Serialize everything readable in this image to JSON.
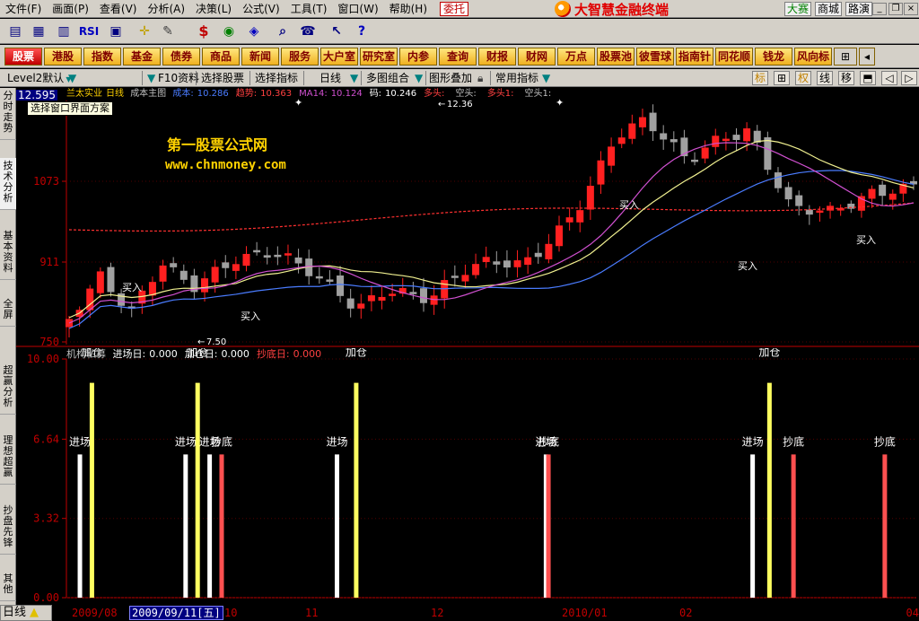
{
  "menu": {
    "items": [
      "文件(F)",
      "画面(P)",
      "查看(V)",
      "分析(A)",
      "决策(L)",
      "公式(V)",
      "工具(T)",
      "窗口(W)",
      "帮助(H)"
    ],
    "trade_button": "委托",
    "brand": "大智慧金融终端",
    "right_buttons": [
      "大赛",
      "商城",
      "路演"
    ]
  },
  "categories": [
    "股票",
    "港股",
    "指数",
    "基金",
    "债券",
    "商品",
    "新闻",
    "服务",
    "大户室",
    "研究室",
    "内参",
    "查询",
    "财报",
    "财网",
    "万点",
    "股票池",
    "彼雪球",
    "指南针",
    "同花顺",
    "钱龙",
    "风向标"
  ],
  "chart_toolbar": {
    "level2": "Level2默认",
    "f10": "F10资料",
    "select_stock": "选择股票",
    "select_indicator": "选择指标",
    "period": "日线",
    "multi_chart": "多图组合",
    "overlay": "图形叠加",
    "common_indicator": "常用指标",
    "right_buttons": [
      "标",
      "⊞",
      "权",
      "线",
      "移"
    ]
  },
  "left_tabs": [
    "分时走势",
    "技术分析",
    "基本资料",
    "全屏",
    "超赢分析",
    "理想超赢",
    "抄盘先锋",
    "其他"
  ],
  "price_chart": {
    "last_price": "12.595",
    "stock_name": "兰太实业",
    "period": "日线",
    "panel_name": "成本主图",
    "tooltip": "选择窗口界面方案",
    "indicators": [
      {
        "label": "成本:",
        "value": "10.286",
        "color": "#4a7cff"
      },
      {
        "label": "趋势:",
        "value": "10.363",
        "color": "#ff4040"
      },
      {
        "label": "MA14:",
        "value": "10.124",
        "color": "#d050d0"
      },
      {
        "label": "码:",
        "value": "10.246",
        "color": "#ffffff"
      },
      {
        "label": "多头:",
        "value": "",
        "color": "#ff4040"
      },
      {
        "label": "空头:",
        "value": "",
        "color": "#c0c0c0"
      },
      {
        "label": "多头1:",
        "value": "",
        "color": "#ff4040"
      },
      {
        "label": "空头1:",
        "value": "",
        "color": "#c0c0c0"
      }
    ],
    "y_ticks": [
      "1073",
      "911",
      "750"
    ],
    "high_label": "12.36",
    "low_label": "7.50",
    "buy_label": "买入",
    "watermark_title": "第一股票公式网",
    "watermark_url": "www.chnmoney.com",
    "colors": {
      "up": "#ff2020",
      "down": "#a0a0a0",
      "cost": "#4a7cff",
      "trend": "#ff3030",
      "ma14": "#d050d0",
      "ma_yellow": "#f0f090"
    }
  },
  "signal_panel": {
    "name": "机构私募",
    "fields": [
      {
        "label": "进场日:",
        "value": "0.000",
        "color": "#ffffff"
      },
      {
        "label": "加仓日:",
        "value": "0.000",
        "color": "#ffffff"
      },
      {
        "label": "抄底日:",
        "value": "0.000",
        "color": "#ff4040"
      }
    ]
  },
  "chart_data": {
    "type": "bar",
    "title": "机构私募",
    "ylim": [
      0,
      10
    ],
    "y_ticks": [
      "10.00",
      "6.64",
      "3.32",
      "0.00"
    ],
    "series": [
      {
        "name": "进场日",
        "color": "#ffffff",
        "value": 6,
        "label": "进场",
        "positions": [
          3,
          47,
          57,
          110,
          197,
          283
        ]
      },
      {
        "name": "加仓日",
        "color": "#ffff60",
        "value": 9,
        "label": "加仓",
        "positions": [
          8,
          52,
          118,
          290
        ]
      },
      {
        "name": "抄底日",
        "color": "#ff5050",
        "value": 6,
        "label": "抄底",
        "positions": [
          62,
          198,
          300,
          338
        ]
      }
    ],
    "x_labels": [
      "2009/08",
      "10",
      "11",
      "12",
      "2010/01",
      "02",
      "04"
    ]
  },
  "date_bar": {
    "period": "日线",
    "cursor_date": "2009/09/11[五]"
  }
}
